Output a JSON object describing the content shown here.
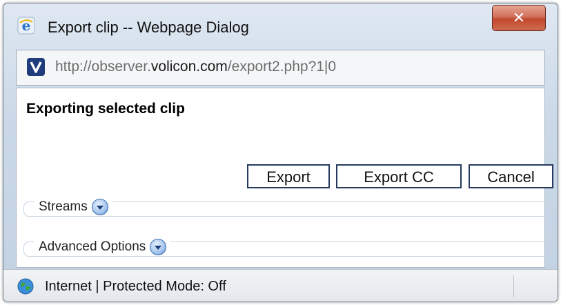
{
  "window": {
    "title": "Export clip -- Webpage Dialog",
    "close_label": "✕"
  },
  "address": {
    "prefix": "http://observer.",
    "domain": "volicon.com",
    "suffix": "/export2.php?1|0"
  },
  "dialog": {
    "heading": "Exporting selected clip",
    "buttons": {
      "export": "Export",
      "export_cc": "Export CC",
      "cancel": "Cancel"
    },
    "sections": [
      {
        "label": "Streams"
      },
      {
        "label": "Advanced Options"
      }
    ]
  },
  "status": {
    "text": "Internet | Protected Mode: Off"
  },
  "colors": {
    "close_button": "#c2492f",
    "button_border": "#253a5e",
    "expand_icon": "#5f8fd1"
  },
  "icons": {
    "app": "internet-explorer-icon",
    "site": "volicon-favicon",
    "expand": "chevron-down-circle-icon",
    "zone": "globe-icon"
  }
}
